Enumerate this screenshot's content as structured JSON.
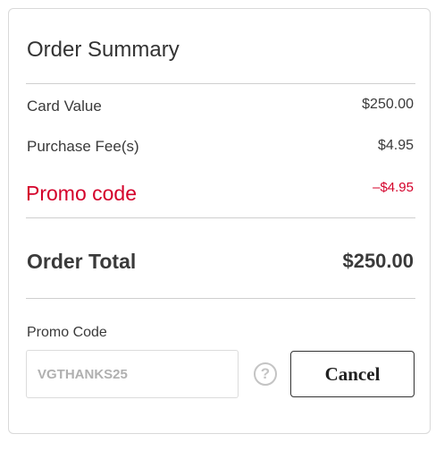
{
  "summary": {
    "title": "Order Summary",
    "rows": [
      {
        "label": "Card Value",
        "value": "$250.00"
      },
      {
        "label": "Purchase Fee(s)",
        "value": "$4.95"
      }
    ],
    "promo": {
      "label": "Promo code",
      "value": "–$4.95"
    },
    "total": {
      "label": "Order Total",
      "value": "$250.00"
    }
  },
  "promo_field": {
    "label": "Promo Code",
    "value": "VGTHANKS25",
    "help_icon": "question-circle-icon",
    "help_glyph": "?"
  },
  "actions": {
    "cancel_label": "Cancel"
  },
  "colors": {
    "promo": "#d4002a",
    "text": "#3a3a3a",
    "border": "#d9d9d9"
  }
}
